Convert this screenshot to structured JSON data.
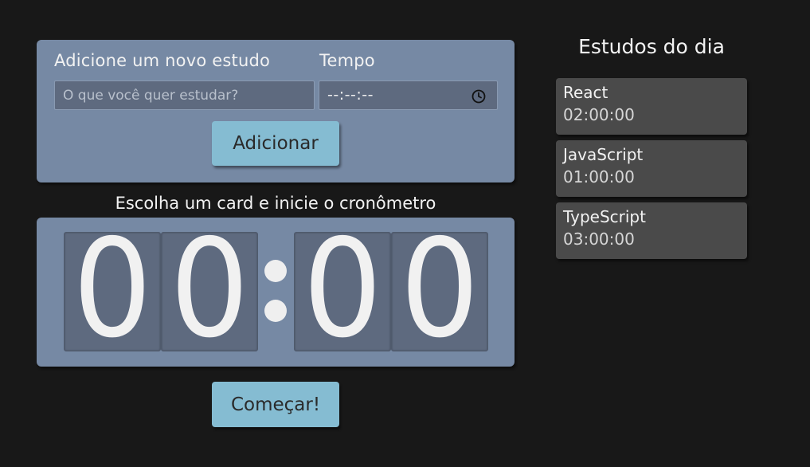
{
  "form": {
    "study_label": "Adicione um novo estudo",
    "time_label": "Tempo",
    "study_placeholder": "O que você quer estudar?",
    "time_value": "--:--:--",
    "add_button": "Adicionar"
  },
  "timer": {
    "title": "Escolha um card e inicie o cronômetro",
    "digits": [
      "0",
      "0",
      "0",
      "0"
    ],
    "start_button": "Começar!"
  },
  "study_list": {
    "title": "Estudos do dia",
    "items": [
      {
        "name": "React",
        "time": "02:00:00"
      },
      {
        "name": "JavaScript",
        "time": "01:00:00"
      },
      {
        "name": "TypeScript",
        "time": "03:00:00"
      }
    ]
  },
  "colors": {
    "background": "#181818",
    "card": "#7689a4",
    "field": "#5e6a7f",
    "button": "#85bcd2",
    "list_item": "#4a4a4a"
  }
}
